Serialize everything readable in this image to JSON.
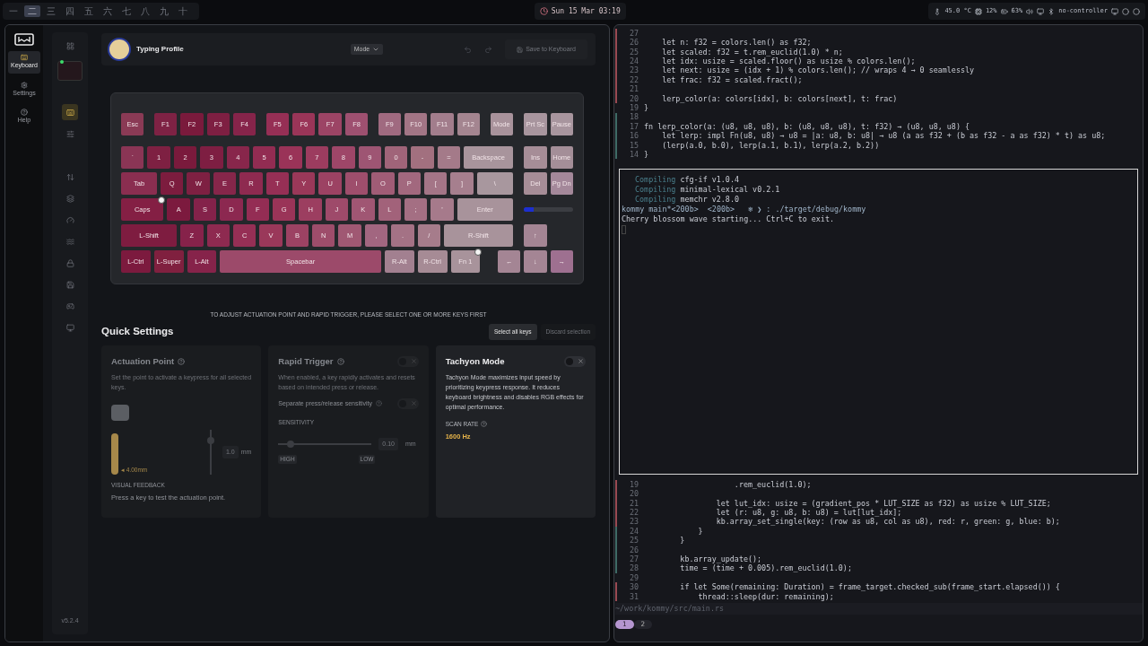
{
  "top_bar": {
    "workspaces": [
      {
        "label": "一",
        "selected": false
      },
      {
        "label": "二",
        "selected": true
      },
      {
        "label": "三",
        "selected": false
      },
      {
        "label": "四",
        "selected": false
      },
      {
        "label": "五",
        "selected": false
      },
      {
        "label": "六",
        "selected": false
      },
      {
        "label": "七",
        "selected": false
      },
      {
        "label": "八",
        "selected": false
      },
      {
        "label": "九",
        "selected": false
      },
      {
        "label": "十",
        "selected": false
      }
    ],
    "clock": "Sun 15 Mar 03:19",
    "status": {
      "temperature": "45.0 °C",
      "cpu": "12%",
      "battery": "63%",
      "controller": "no-controller"
    }
  },
  "app": {
    "nav": [
      {
        "label": "Keyboard",
        "selected": true
      },
      {
        "label": "Settings",
        "selected": false
      },
      {
        "label": "Help",
        "selected": false
      }
    ],
    "device": {
      "connected": true
    },
    "tools": [
      {
        "selected": false
      },
      {
        "selected": true
      },
      {
        "selected": false
      },
      {
        "selected": false
      },
      {
        "selected": false
      },
      {
        "selected": false
      },
      {
        "selected": false
      },
      {
        "selected": false
      },
      {
        "selected": false
      },
      {
        "selected": false
      },
      {
        "selected": false
      }
    ],
    "version": "v5.2.4",
    "header": {
      "title": "Typing Profile",
      "mode": "Mode",
      "save": "Save to Keyboard",
      "save_disabled": true
    },
    "keyboard": {
      "rows": [
        {
          "main": [
            [
              {
                "label": "Esc",
                "color": "#8a3a55",
                "led": false
              }
            ],
            [
              {
                "label": "F1",
                "color": "#7e2244",
                "led": false
              },
              {
                "label": "F2",
                "color": "#7a1a3c",
                "led": false
              },
              {
                "label": "F3",
                "color": "#7e1f42",
                "led": false
              },
              {
                "label": "F4",
                "color": "#86244a",
                "led": false
              }
            ],
            [
              {
                "label": "F5",
                "color": "#962f55",
                "led": false
              },
              {
                "label": "F6",
                "color": "#9a3558",
                "led": false
              },
              {
                "label": "F7",
                "color": "#9c4465",
                "led": false
              },
              {
                "label": "F8",
                "color": "#9e5070",
                "led": false
              }
            ],
            [
              {
                "label": "F9",
                "color": "#a06a80",
                "led": false
              },
              {
                "label": "F10",
                "color": "#a27585",
                "led": false
              },
              {
                "label": "F11",
                "color": "#a27d8c",
                "led": false
              },
              {
                "label": "F12",
                "color": "#a48590",
                "led": false
              }
            ],
            [
              {
                "label": "Mode",
                "color": "#a8929b",
                "led": false
              }
            ]
          ],
          "side": [
            {
              "label": "Prt Sc",
              "color": "#a8959e",
              "led": false
            },
            {
              "label": "Pause",
              "color": "#a8959e",
              "led": false
            }
          ]
        },
        {
          "main": [
            [
              {
                "label": "`",
                "color": "#8a3555",
                "led": false
              },
              {
                "label": "1",
                "color": "#7e2042",
                "led": false
              },
              {
                "label": "2",
                "color": "#7a1a3c",
                "led": false
              },
              {
                "label": "3",
                "color": "#7e1e42",
                "led": false
              },
              {
                "label": "4",
                "color": "#88264b",
                "led": false
              },
              {
                "label": "5",
                "color": "#922c52",
                "led": false
              },
              {
                "label": "6",
                "color": "#9a3358",
                "led": false
              },
              {
                "label": "7",
                "color": "#9c3c5f",
                "led": false
              },
              {
                "label": "8",
                "color": "#9e4668",
                "led": false
              },
              {
                "label": "9",
                "color": "#9e5573",
                "led": false
              },
              {
                "label": "0",
                "color": "#a06479",
                "led": false
              },
              {
                "label": "-",
                "color": "#a2707f",
                "led": false
              },
              {
                "label": "=",
                "color": "#a47a89",
                "led": false
              },
              {
                "label": "Backspace",
                "color": "#a8949c",
                "led": false
              }
            ]
          ],
          "side": [
            {
              "label": "Ins",
              "color": "#a68d97",
              "led": false
            },
            {
              "label": "Home",
              "color": "#a48e98",
              "led": false
            }
          ]
        },
        {
          "main": [
            [
              {
                "label": "Tab",
                "color": "#8a2e50",
                "led": false
              },
              {
                "label": "Q",
                "color": "#7c1c3e",
                "led": false
              },
              {
                "label": "W",
                "color": "#7e2042",
                "led": false
              },
              {
                "label": "E",
                "color": "#86264a",
                "led": false
              },
              {
                "label": "R",
                "color": "#8e2a50",
                "led": false
              },
              {
                "label": "T",
                "color": "#962f55",
                "led": false
              },
              {
                "label": "Y",
                "color": "#9a3859",
                "led": false
              },
              {
                "label": "U",
                "color": "#9c4263",
                "led": false
              },
              {
                "label": "I",
                "color": "#9e4e6c",
                "led": false
              },
              {
                "label": "O",
                "color": "#a05c76",
                "led": false
              },
              {
                "label": "P",
                "color": "#a2687e",
                "led": false
              },
              {
                "label": "[",
                "color": "#a47587",
                "led": false
              },
              {
                "label": "]",
                "color": "#a67f8e",
                "led": false
              },
              {
                "label": "\\",
                "color": "#a8979e",
                "led": false
              }
            ]
          ],
          "side": [
            {
              "label": "Del",
              "color": "#a68d97",
              "led": false
            },
            {
              "label": "Pg Dn",
              "color": "#a4889a",
              "led": false
            }
          ]
        },
        {
          "main": [
            [
              {
                "label": "Caps",
                "color": "#841f44",
                "led": true
              },
              {
                "label": "A",
                "color": "#7c1a3e",
                "led": false
              },
              {
                "label": "S",
                "color": "#84224a",
                "led": false
              },
              {
                "label": "D",
                "color": "#8c2850",
                "led": false
              },
              {
                "label": "F",
                "color": "#942d54",
                "led": false
              },
              {
                "label": "G",
                "color": "#9a3458",
                "led": false
              },
              {
                "label": "H",
                "color": "#9c3e60",
                "led": false
              },
              {
                "label": "J",
                "color": "#9e4a6a",
                "led": false
              },
              {
                "label": "K",
                "color": "#a05673",
                "led": false
              },
              {
                "label": "L",
                "color": "#a2627a",
                "led": false
              },
              {
                "label": ";",
                "color": "#a46f83",
                "led": false
              },
              {
                "label": "'",
                "color": "#a67a8b",
                "led": false
              },
              {
                "label": "Enter",
                "color": "#a8939b",
                "led": false
              }
            ]
          ],
          "side": [],
          "level": 0.2
        },
        {
          "main": [
            [
              {
                "label": "L-Shift",
                "color": "#7e1c40",
                "led": false
              },
              {
                "label": "Z",
                "color": "#86224a",
                "led": false
              },
              {
                "label": "X",
                "color": "#8e2a50",
                "led": false
              },
              {
                "label": "C",
                "color": "#962f55",
                "led": false
              },
              {
                "label": "V",
                "color": "#9a385a",
                "led": false
              },
              {
                "label": "B",
                "color": "#9c4263",
                "led": false
              },
              {
                "label": "N",
                "color": "#9e4d6b",
                "led": false
              },
              {
                "label": "M",
                "color": "#a05873",
                "led": false
              },
              {
                "label": ",",
                "color": "#a26680",
                "led": false
              },
              {
                "label": ".",
                "color": "#a47285",
                "led": false
              },
              {
                "label": "/",
                "color": "#a67c8b",
                "led": false
              },
              {
                "label": "R-Shift",
                "color": "#a8939b",
                "led": false
              }
            ]
          ],
          "side": [
            {
              "label": "↑",
              "color": "#a48594",
              "led": false
            }
          ]
        },
        {
          "main": [
            [
              {
                "label": "L-Ctrl",
                "color": "#7c1a3e",
                "led": false
              },
              {
                "label": "L-Super",
                "color": "#80203f",
                "led": false
              },
              {
                "label": "L-Alt",
                "color": "#86234a",
                "led": false
              },
              {
                "label": "Spacebar",
                "color": "#9c4a6a",
                "led": false
              },
              {
                "label": "R-Alt",
                "color": "#a28090",
                "led": false
              },
              {
                "label": "R-Ctrl",
                "color": "#a68b95",
                "led": false
              },
              {
                "label": "Fn 1",
                "color": "#a8939b",
                "led": true
              }
            ]
          ],
          "side": [
            {
              "label": "←",
              "color": "#a48594",
              "led": false
            },
            {
              "label": "↓",
              "color": "#a48594",
              "led": false
            },
            {
              "label": "→",
              "color": "#9e7090",
              "led": false
            }
          ]
        }
      ]
    },
    "notice": "TO ADJUST ACTUATION POINT AND RAPID TRIGGER, PLEASE SELECT ONE OR MORE KEYS FIRST",
    "quick_settings": {
      "title": "Quick Settings",
      "select_all": "Select all keys",
      "discard": "Discard selection",
      "discard_disabled": true,
      "actuation": {
        "title": "Actuation Point",
        "disabled": true,
        "description": "Set the point to activate a keypress for all selected keys.",
        "marker": "◂ 4.00mm",
        "level": 0.8,
        "value": "1.0",
        "unit": "mm",
        "feedback_title": "VISUAL FEEDBACK",
        "feedback_text": "Press a key to test the actuation point."
      },
      "rapid": {
        "title": "Rapid Trigger",
        "disabled": true,
        "on": false,
        "description": "When enabled, a key rapidly activates and resets based on intended press or release.",
        "separate_label": "Separate press/release sensitivity",
        "separate_on": false,
        "sensitivity_title": "SENSITIVITY",
        "level": 0.1,
        "value": "0.10",
        "unit": "mm",
        "high": "HIGH",
        "low": "LOW"
      },
      "tachyon": {
        "title": "Tachyon Mode",
        "disabled": false,
        "on": false,
        "description": "Tachyon Mode maximizes input speed by prioritizing keypress response. It reduces keyboard brightness and disables RGB effects for optimal performance.",
        "scan_title": "SCAN RATE",
        "scan_value": "1600 Hz"
      }
    }
  },
  "terminal": {
    "top_pane": [
      {
        "num": "27",
        "color": "#9a4a52"
      },
      {
        "num": "26",
        "text": "    let n: f32 = colors.len() as f32;",
        "color": "#9a4a52"
      },
      {
        "num": "25",
        "text": "    let scaled: f32 = t.rem_euclid(1.0) * n;",
        "color": "#9a4a52"
      },
      {
        "num": "24",
        "text": "    let idx: usize = scaled.floor() as usize % colors.len();",
        "color": "#9a4a52"
      },
      {
        "num": "23",
        "text": "    let next: usize = (idx + 1) % colors.len(); // wraps 4 → 0 seamlessly",
        "color": "#9a4a52"
      },
      {
        "num": "22",
        "text": "    let frac: f32 = scaled.fract();",
        "color": "#9a4a52"
      },
      {
        "num": "21",
        "color": "#9a4a52"
      },
      {
        "num": "20",
        "text": "    lerp_color(a: colors[idx], b: colors[next], t: frac)",
        "color": "#9a4a52"
      },
      {
        "num": "19",
        "text": "}"
      },
      {
        "num": "18",
        "color": "#3f6b66"
      },
      {
        "num": "17",
        "text": "fn lerp_color(a: (u8, u8, u8), b: (u8, u8, u8), t: f32) → (u8, u8, u8) {",
        "color": "#3f6b66"
      },
      {
        "num": "16",
        "text": "    let lerp: impl Fn(u8, u8) → u8 = |a: u8, b: u8| → u8 (a as f32 + (b as f32 - a as f32) * t) as u8;",
        "color": "#3f6b66"
      },
      {
        "num": "15",
        "text": "    (lerp(a.0, b.0), lerp(a.1, b.1), lerp(a.2, b.2))",
        "color": "#3f6b66"
      },
      {
        "num": "14",
        "text": "}",
        "color": "#3f6b66"
      }
    ],
    "output": [
      {
        "kind": "compile",
        "verb": "Compiling",
        "text": "cfg-if v1.0.4"
      },
      {
        "kind": "compile",
        "verb": "Compiling",
        "text": "minimal-lexical v0.2.1"
      },
      {
        "kind": "compile",
        "verb": "Compiling",
        "text": "memchr v2.8.0"
      },
      {
        "kind": "prompt",
        "text": "kommy main*<200b>  <200b>   ❄ ❯ : ./target/debug/kommy"
      },
      {
        "kind": "output",
        "text": "Cherry blossom wave starting... Ctrl+C to exit."
      }
    ],
    "bottom_pane": [
      {
        "num": "19",
        "text": "                    .rem_euclid(1.0);",
        "color": "#9a4a52"
      },
      {
        "num": "20",
        "color": "#9a4a52"
      },
      {
        "num": "21",
        "text": "                let lut_idx: usize = (gradient_pos * LUT_SIZE as f32) as usize % LUT_SIZE;",
        "color": "#9a4a52"
      },
      {
        "num": "22",
        "text": "                let (r: u8, g: u8, b: u8) = lut[lut_idx];",
        "color": "#9a4a52"
      },
      {
        "num": "23",
        "text": "                kb.array_set_single(key: (row as u8, col as u8), red: r, green: g, blue: b);",
        "color": "#9a4a52"
      },
      {
        "num": "24",
        "text": "            }",
        "color": "#3f6b66"
      },
      {
        "num": "25",
        "text": "        }",
        "color": "#3f6b66"
      },
      {
        "num": "26",
        "color": "#3f6b66"
      },
      {
        "num": "27",
        "text": "        kb.array_update();",
        "color": "#3f6b66"
      },
      {
        "num": "28",
        "text": "        time = (time + 0.005).rem_euclid(1.0);",
        "color": "#3f6b66"
      },
      {
        "num": "29"
      },
      {
        "num": "30",
        "text": "        if let Some(remaining: Duration) = frame_target.checked_sub(frame_start.elapsed()) {",
        "color": "#9a4a52"
      },
      {
        "num": "31",
        "text": "            thread::sleep(dur: remaining);",
        "color": "#9a4a52"
      }
    ],
    "file_path": "~/work/kommy/src/main.rs",
    "tabs": [
      {
        "label": "1",
        "selected": true
      },
      {
        "label": "2",
        "selected": false
      }
    ]
  }
}
